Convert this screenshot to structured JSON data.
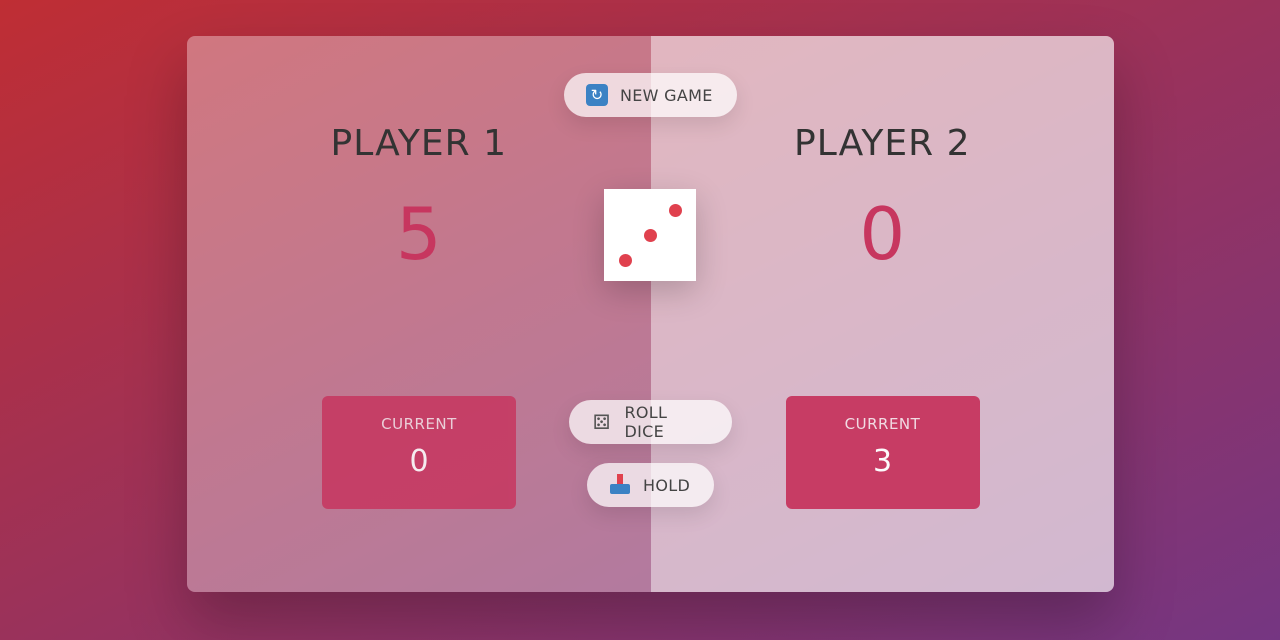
{
  "players": [
    {
      "name": "PLAYER 1",
      "score": "5",
      "current_label": "CURRENT",
      "current_score": "0"
    },
    {
      "name": "PLAYER 2",
      "score": "0",
      "current_label": "CURRENT",
      "current_score": "3"
    }
  ],
  "buttons": {
    "new_game": {
      "label": "NEW GAME",
      "icon": "refresh-icon"
    },
    "roll_dice": {
      "label": "ROLL DICE",
      "icon": "dice-icon"
    },
    "hold": {
      "label": "HOLD",
      "icon": "inbox-tray-icon"
    }
  },
  "dice": {
    "value": 3
  },
  "colors": {
    "accent": "#c7365f",
    "pip": "#e0414e",
    "gradient_start": "#bf2e34",
    "gradient_end": "#753682"
  }
}
